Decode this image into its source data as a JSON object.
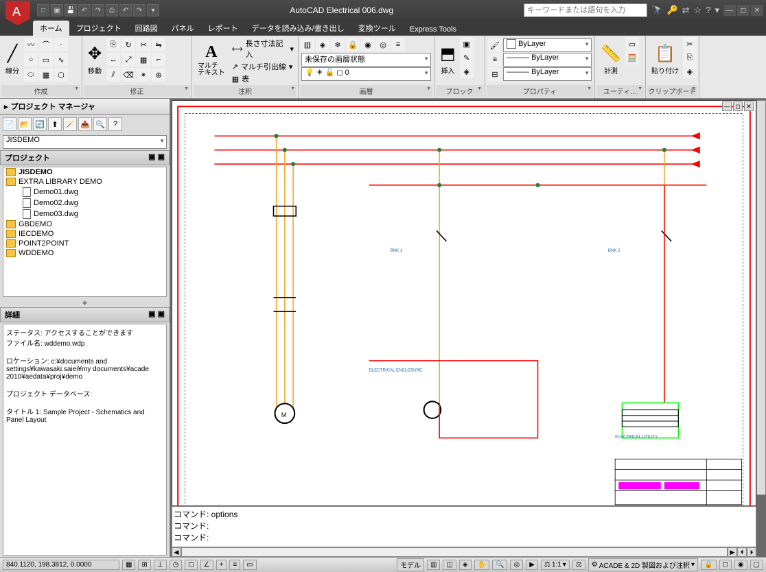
{
  "app": {
    "title": "AutoCAD Electrical   006.dwg",
    "searchPlaceholder": "キーワードまたは語句を入力"
  },
  "tabs": {
    "home": "ホーム",
    "project": "プロジェクト",
    "circuit": "回路図",
    "panel": "パネル",
    "report": "レポート",
    "data": "データを読み込み/書き出し",
    "convert": "変換ツール",
    "express": "Express Tools"
  },
  "ribbon": {
    "create_label": "作成",
    "line": "線分",
    "move_label": "移動",
    "modify_label": "修正",
    "multitext": "マルチ\nテキスト",
    "annotation_label": "注釈",
    "dim": "長さ寸法記入",
    "mleader": "マルチ引出線",
    "table": "表",
    "layer_dropdown": "未保存の画層状態",
    "layer_label": "画層",
    "insert": "挿入",
    "block_label": "ブロック",
    "bylayer1": "ByLayer",
    "bylayer2": "ByLayer",
    "bylayer3": "ByLayer",
    "prop_label": "プロパティ",
    "measure": "計測",
    "util_label": "ユーティ…",
    "paste": "貼り付け",
    "clip_label": "クリップボード"
  },
  "sidebar": {
    "title": "プロジェクト マネージャ",
    "combo": "JISDEMO",
    "project_hdr": "プロジェクト",
    "tree": {
      "jisdemo": "JISDEMO",
      "extra": "EXTRA LIBRARY DEMO",
      "d1": "Demo01.dwg",
      "d2": "Demo02.dwg",
      "d3": "Demo03.dwg",
      "gb": "GBDEMO",
      "iec": "IECDEMO",
      "p2p": "POINT2POINT",
      "wd": "WDDEMO"
    },
    "details_hdr": "詳細",
    "details": {
      "l1": "ステータス: アクセスすることができます",
      "l2": "ファイル名: wddemo.wdp",
      "l3": "ロケーション: c:¥documents and settings¥kawasaki.saiei¥my documents¥acade 2010¥aedata¥proj¥demo",
      "l4": "プロジェクト データベース:",
      "l5": "タイトル 1: Sample Project - Schematics and Panel Layout"
    }
  },
  "command": {
    "l1": "コマンド: options",
    "l2": "コマンド:",
    "l3": "コマンド:"
  },
  "status": {
    "coords": "840.1120, 198.3812, 0.0000",
    "model": "モデル",
    "scale": "1:1",
    "anno": "ACADE & 2D 製図および注釈"
  }
}
